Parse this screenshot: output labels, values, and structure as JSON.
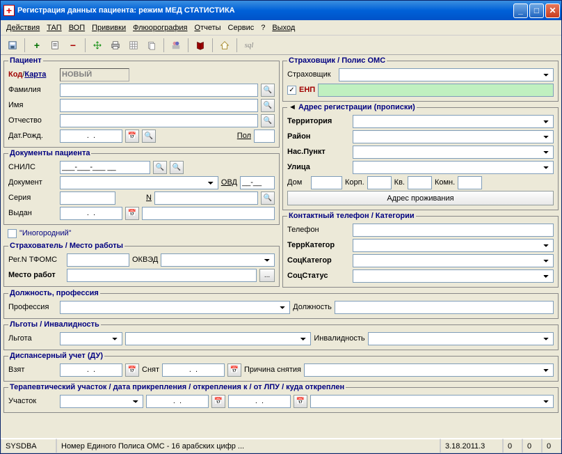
{
  "title": "Регистрация данных пациента: режим МЕД СТАТИСТИКА",
  "menu": {
    "actions": "Действия",
    "tap": "ТАП",
    "vop": "ВОП",
    "priv": "Прививки",
    "fluoro": "Флюорография",
    "reports": "Отчеты",
    "service": "Сервис",
    "help": "?",
    "exit": "Выход"
  },
  "toolbar": {
    "sql": "sql"
  },
  "patient": {
    "legend": "Пациент",
    "kod": "Код",
    "karta": "Карта",
    "code_value": "НОВЫЙ",
    "fam_label": "Фамилия",
    "name_label": "Имя",
    "patr_label": "Отчество",
    "dob_label": "Дат.Рожд.",
    "dob_value": ".  .",
    "sex_label": "Пол"
  },
  "docs": {
    "legend": "Документы пациента",
    "snils_label": "СНИЛС",
    "snils_value": "___-___-___ __",
    "doc_label": "Документ",
    "ovd_label": "ОВД",
    "ovd_value": "__-__",
    "series_label": "Серия",
    "n_label": "N",
    "issued_label": "Выдан",
    "date_value": ".  ."
  },
  "nonresident": {
    "label": "\"Иногородний\""
  },
  "insurer_work": {
    "legend": "Страхователь  /  Место работы",
    "reg_label": "Рег.N ТФОМС",
    "okved_label": "ОКВЭД",
    "workplace_label": "Место работ",
    "dots": "..."
  },
  "insurer": {
    "legend": "Страховщик / Полис ОМС",
    "ins_label": "Страховщик",
    "enp_checked": true,
    "enp_label": "ЕНП"
  },
  "address": {
    "legend": "Адрес регистрации (прописки)",
    "terr_label": "Территория",
    "rayon_label": "Район",
    "np_label": "Нас.Пункт",
    "street_label": "Улица",
    "house_label": "Дом",
    "korp_label": "Корп.",
    "kv_label": "Кв.",
    "komn_label": "Комн.",
    "residence_btn": "Адрес проживания"
  },
  "phone_cat": {
    "legend": "Контактный телефон  /  Категории",
    "phone_label": "Телефон",
    "terrcat_label": "ТеррКатегор",
    "soccat_label": "СоцКатегор",
    "socstat_label": "СоцСтатус"
  },
  "position": {
    "legend": "Должность, профессия",
    "prof_label": "Профессия",
    "pos_label": "Должность"
  },
  "lgoty": {
    "legend": "Льготы / Инвалидность",
    "lgota_label": "Льгота",
    "inv_label": "Инвалидность"
  },
  "dispanser": {
    "legend": "Диспансерный учет (ДУ)",
    "taken_label": "Взят",
    "removed_label": "Снят",
    "reason_label": "Причина снятия",
    "date_value": ".  ."
  },
  "uchastok": {
    "legend": "Терапевтический участок / дата прикрепления / открепления к / от ЛПУ / куда откреплен",
    "label": "Участок",
    "date_value": ".  ."
  },
  "status": {
    "user": "SYSDBA",
    "hint": "Номер Единого Полиса ОМС - 16 арабских цифр ...",
    "version": "3.18.2011.3",
    "n1": "0",
    "n2": "0",
    "n3": "0"
  }
}
